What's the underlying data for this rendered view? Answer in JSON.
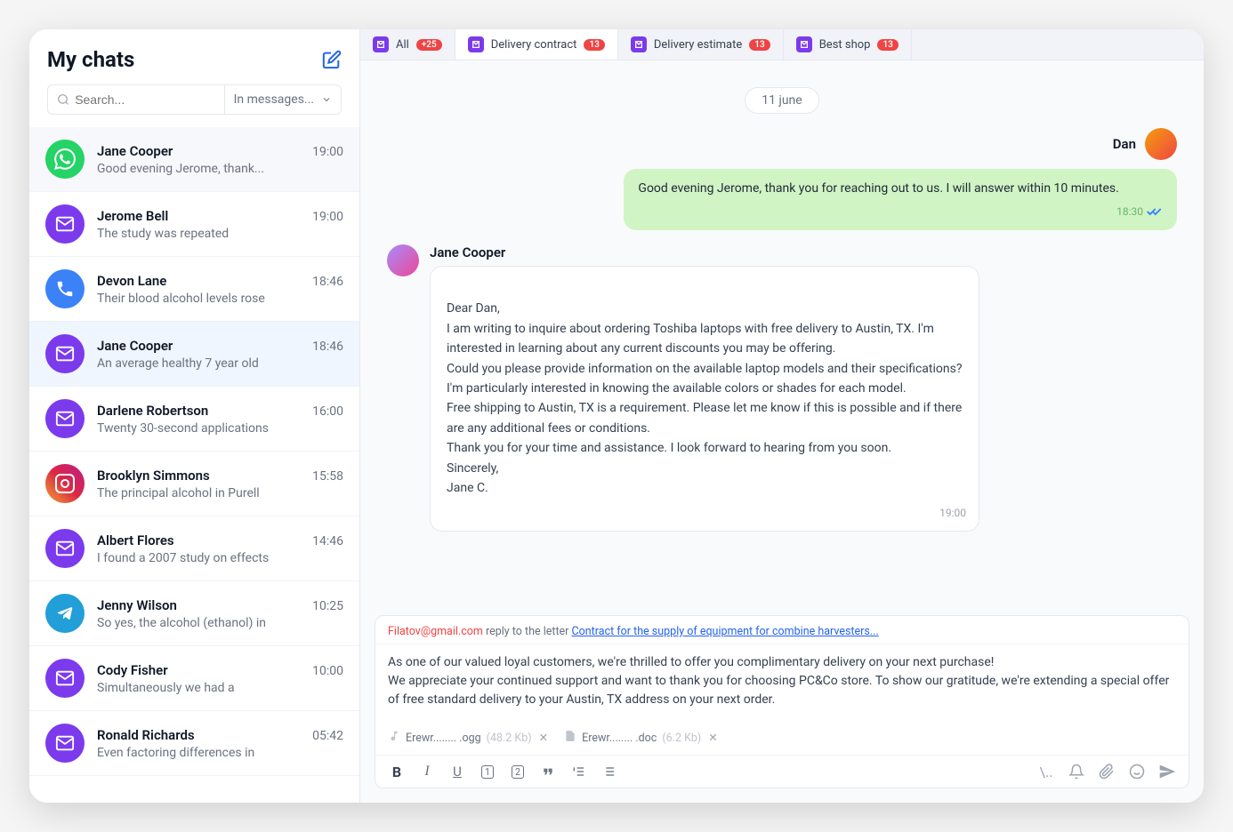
{
  "sidebar": {
    "title": "My chats",
    "search_placeholder": "Search...",
    "filter_label": "In messages..."
  },
  "chats": [
    {
      "name": "Jane Cooper",
      "time": "19:00",
      "preview": "Good evening Jerome, thank...",
      "avatar": "whatsapp",
      "state": "hover"
    },
    {
      "name": "Jerome Bell",
      "time": "19:00",
      "preview": "The study was repeated",
      "avatar": "mail",
      "state": ""
    },
    {
      "name": "Devon Lane",
      "time": "18:46",
      "preview": "Their blood alcohol levels rose",
      "avatar": "phone",
      "state": ""
    },
    {
      "name": "Jane Cooper",
      "time": "18:46",
      "preview": "An average healthy 7 year old",
      "avatar": "mail",
      "state": "active"
    },
    {
      "name": "Darlene Robertson",
      "time": "16:00",
      "preview": "Twenty 30-second applications",
      "avatar": "mail",
      "state": ""
    },
    {
      "name": "Brooklyn Simmons",
      "time": "15:58",
      "preview": "The principal alcohol in Purell",
      "avatar": "instagram",
      "state": ""
    },
    {
      "name": "Albert Flores",
      "time": "14:46",
      "preview": "I found a 2007 study on effects",
      "avatar": "mail",
      "state": ""
    },
    {
      "name": "Jenny Wilson",
      "time": "10:25",
      "preview": "So yes, the alcohol (ethanol) in",
      "avatar": "telegram",
      "state": ""
    },
    {
      "name": "Cody Fisher",
      "time": "10:00",
      "preview": "Simultaneously we had a",
      "avatar": "mail",
      "state": ""
    },
    {
      "name": "Ronald Richards",
      "time": "05:42",
      "preview": "Even factoring differences in",
      "avatar": "mail",
      "state": ""
    }
  ],
  "tabs": [
    {
      "label": "All",
      "badge": "+25",
      "active": false
    },
    {
      "label": "Delivery contract",
      "badge": "13",
      "active": true
    },
    {
      "label": "Delivery estimate",
      "badge": "13",
      "active": false
    },
    {
      "label": "Best shop",
      "badge": "13",
      "active": false
    }
  ],
  "conversation": {
    "date_label": "11 june",
    "out_name": "Dan",
    "out_text": "Good evening Jerome, thank you for reaching out to us. I will answer within 10 minutes.",
    "out_time": "18:30",
    "in_name": "Jane Cooper",
    "in_text": "Dear Dan,\nI am writing to inquire about ordering Toshiba laptops with free delivery to Austin, TX. I'm interested in learning about any current discounts you may be offering.\nCould you please provide information on the available laptop models and their specifications? I'm particularly interested in knowing the available colors or shades for each model.\nFree shipping to Austin, TX is a requirement. Please let me know if this is possible and if there are any additional fees or conditions.\nThank you for your time and assistance. I look forward to hearing from you soon.\nSincerely,\nJane C.",
    "in_time": "19:00"
  },
  "composer": {
    "reply_email": "Filatov@gmail.com",
    "reply_text": " reply to the letter ",
    "reply_subject": "Contract for the supply of equipment for combine harvesters...",
    "body": "As one of our valued loyal customers, we're thrilled to offer you complimentary delivery on your next purchase!\nWe appreciate your continued support and want to thank you for choosing PC&Co store. To show our gratitude, we're extending a special offer of free standard delivery to your Austin, TX address on your next order.",
    "attachments": [
      {
        "name": "Erewr........ .ogg",
        "size": "(48.2 Kb)",
        "icon": "audio"
      },
      {
        "name": "Erewr........ .doc",
        "size": "(6.2 Kb)",
        "icon": "doc"
      }
    ]
  }
}
